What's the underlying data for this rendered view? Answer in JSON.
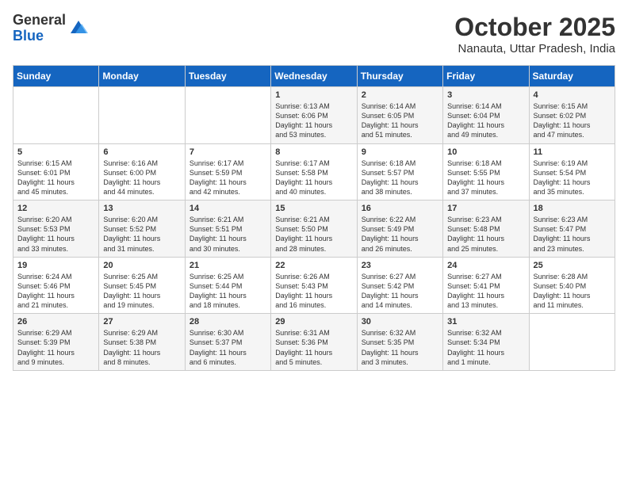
{
  "logo": {
    "general": "General",
    "blue": "Blue"
  },
  "title": "October 2025",
  "location": "Nanauta, Uttar Pradesh, India",
  "headers": [
    "Sunday",
    "Monday",
    "Tuesday",
    "Wednesday",
    "Thursday",
    "Friday",
    "Saturday"
  ],
  "weeks": [
    [
      {
        "day": "",
        "info": ""
      },
      {
        "day": "",
        "info": ""
      },
      {
        "day": "",
        "info": ""
      },
      {
        "day": "1",
        "info": "Sunrise: 6:13 AM\nSunset: 6:06 PM\nDaylight: 11 hours\nand 53 minutes."
      },
      {
        "day": "2",
        "info": "Sunrise: 6:14 AM\nSunset: 6:05 PM\nDaylight: 11 hours\nand 51 minutes."
      },
      {
        "day": "3",
        "info": "Sunrise: 6:14 AM\nSunset: 6:04 PM\nDaylight: 11 hours\nand 49 minutes."
      },
      {
        "day": "4",
        "info": "Sunrise: 6:15 AM\nSunset: 6:02 PM\nDaylight: 11 hours\nand 47 minutes."
      }
    ],
    [
      {
        "day": "5",
        "info": "Sunrise: 6:15 AM\nSunset: 6:01 PM\nDaylight: 11 hours\nand 45 minutes."
      },
      {
        "day": "6",
        "info": "Sunrise: 6:16 AM\nSunset: 6:00 PM\nDaylight: 11 hours\nand 44 minutes."
      },
      {
        "day": "7",
        "info": "Sunrise: 6:17 AM\nSunset: 5:59 PM\nDaylight: 11 hours\nand 42 minutes."
      },
      {
        "day": "8",
        "info": "Sunrise: 6:17 AM\nSunset: 5:58 PM\nDaylight: 11 hours\nand 40 minutes."
      },
      {
        "day": "9",
        "info": "Sunrise: 6:18 AM\nSunset: 5:57 PM\nDaylight: 11 hours\nand 38 minutes."
      },
      {
        "day": "10",
        "info": "Sunrise: 6:18 AM\nSunset: 5:55 PM\nDaylight: 11 hours\nand 37 minutes."
      },
      {
        "day": "11",
        "info": "Sunrise: 6:19 AM\nSunset: 5:54 PM\nDaylight: 11 hours\nand 35 minutes."
      }
    ],
    [
      {
        "day": "12",
        "info": "Sunrise: 6:20 AM\nSunset: 5:53 PM\nDaylight: 11 hours\nand 33 minutes."
      },
      {
        "day": "13",
        "info": "Sunrise: 6:20 AM\nSunset: 5:52 PM\nDaylight: 11 hours\nand 31 minutes."
      },
      {
        "day": "14",
        "info": "Sunrise: 6:21 AM\nSunset: 5:51 PM\nDaylight: 11 hours\nand 30 minutes."
      },
      {
        "day": "15",
        "info": "Sunrise: 6:21 AM\nSunset: 5:50 PM\nDaylight: 11 hours\nand 28 minutes."
      },
      {
        "day": "16",
        "info": "Sunrise: 6:22 AM\nSunset: 5:49 PM\nDaylight: 11 hours\nand 26 minutes."
      },
      {
        "day": "17",
        "info": "Sunrise: 6:23 AM\nSunset: 5:48 PM\nDaylight: 11 hours\nand 25 minutes."
      },
      {
        "day": "18",
        "info": "Sunrise: 6:23 AM\nSunset: 5:47 PM\nDaylight: 11 hours\nand 23 minutes."
      }
    ],
    [
      {
        "day": "19",
        "info": "Sunrise: 6:24 AM\nSunset: 5:46 PM\nDaylight: 11 hours\nand 21 minutes."
      },
      {
        "day": "20",
        "info": "Sunrise: 6:25 AM\nSunset: 5:45 PM\nDaylight: 11 hours\nand 19 minutes."
      },
      {
        "day": "21",
        "info": "Sunrise: 6:25 AM\nSunset: 5:44 PM\nDaylight: 11 hours\nand 18 minutes."
      },
      {
        "day": "22",
        "info": "Sunrise: 6:26 AM\nSunset: 5:43 PM\nDaylight: 11 hours\nand 16 minutes."
      },
      {
        "day": "23",
        "info": "Sunrise: 6:27 AM\nSunset: 5:42 PM\nDaylight: 11 hours\nand 14 minutes."
      },
      {
        "day": "24",
        "info": "Sunrise: 6:27 AM\nSunset: 5:41 PM\nDaylight: 11 hours\nand 13 minutes."
      },
      {
        "day": "25",
        "info": "Sunrise: 6:28 AM\nSunset: 5:40 PM\nDaylight: 11 hours\nand 11 minutes."
      }
    ],
    [
      {
        "day": "26",
        "info": "Sunrise: 6:29 AM\nSunset: 5:39 PM\nDaylight: 11 hours\nand 9 minutes."
      },
      {
        "day": "27",
        "info": "Sunrise: 6:29 AM\nSunset: 5:38 PM\nDaylight: 11 hours\nand 8 minutes."
      },
      {
        "day": "28",
        "info": "Sunrise: 6:30 AM\nSunset: 5:37 PM\nDaylight: 11 hours\nand 6 minutes."
      },
      {
        "day": "29",
        "info": "Sunrise: 6:31 AM\nSunset: 5:36 PM\nDaylight: 11 hours\nand 5 minutes."
      },
      {
        "day": "30",
        "info": "Sunrise: 6:32 AM\nSunset: 5:35 PM\nDaylight: 11 hours\nand 3 minutes."
      },
      {
        "day": "31",
        "info": "Sunrise: 6:32 AM\nSunset: 5:34 PM\nDaylight: 11 hours\nand 1 minute."
      },
      {
        "day": "",
        "info": ""
      }
    ]
  ]
}
